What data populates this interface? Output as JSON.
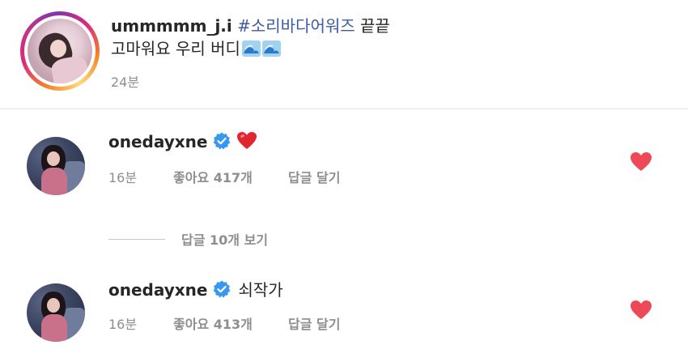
{
  "caption": {
    "username": "ummmmm_j.i",
    "hashtag": "#소리바다어워즈",
    "text_after_hashtag": "끝끝",
    "line2": "고마워요 우리 버디",
    "time": "24분"
  },
  "comments": [
    {
      "username": "onedayxne",
      "text": "",
      "time": "16분",
      "likes": "좋아요 417개",
      "reply": "답글 달기",
      "has_heart_emoji": true
    },
    {
      "username": "onedayxne",
      "text": "쇠작가",
      "time": "16분",
      "likes": "좋아요 413개",
      "reply": "답글 달기",
      "has_heart_emoji": false
    }
  ],
  "view_replies": {
    "label": "답글 10개 보기"
  },
  "colors": {
    "text": "#262626",
    "muted": "#8e8e8e",
    "hashtag": "#3b5aa8",
    "verified": "#3897f0",
    "like_heart": "#ed4956"
  },
  "icons": {
    "verified": "verified-badge-icon",
    "like": "heart-icon",
    "emoji_heart": "red-heart-emoji",
    "emoji_wave": "water-wave-emoji"
  }
}
